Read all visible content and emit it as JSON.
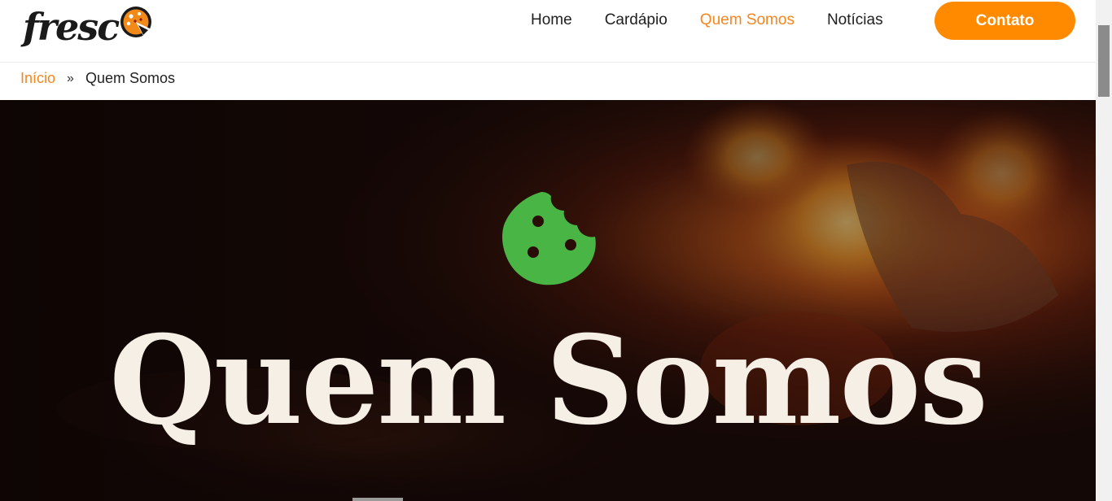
{
  "header": {
    "logo_text": "fresc",
    "logo_icon": "pizza-icon",
    "nav": [
      {
        "label": "Home",
        "active": false
      },
      {
        "label": "Cardápio",
        "active": false
      },
      {
        "label": "Quem Somos",
        "active": true
      },
      {
        "label": "Notícias",
        "active": false
      }
    ],
    "contact_label": "Contato"
  },
  "breadcrumb": {
    "home": "Início",
    "separator": "»",
    "current": "Quem Somos"
  },
  "hero": {
    "title": "Quem Somos",
    "badge_icon": "cookie-icon",
    "badge_color": "#48b544"
  },
  "colors": {
    "accent": "#f7851e",
    "button": "#ff8a00",
    "title": "#f6efe6"
  }
}
